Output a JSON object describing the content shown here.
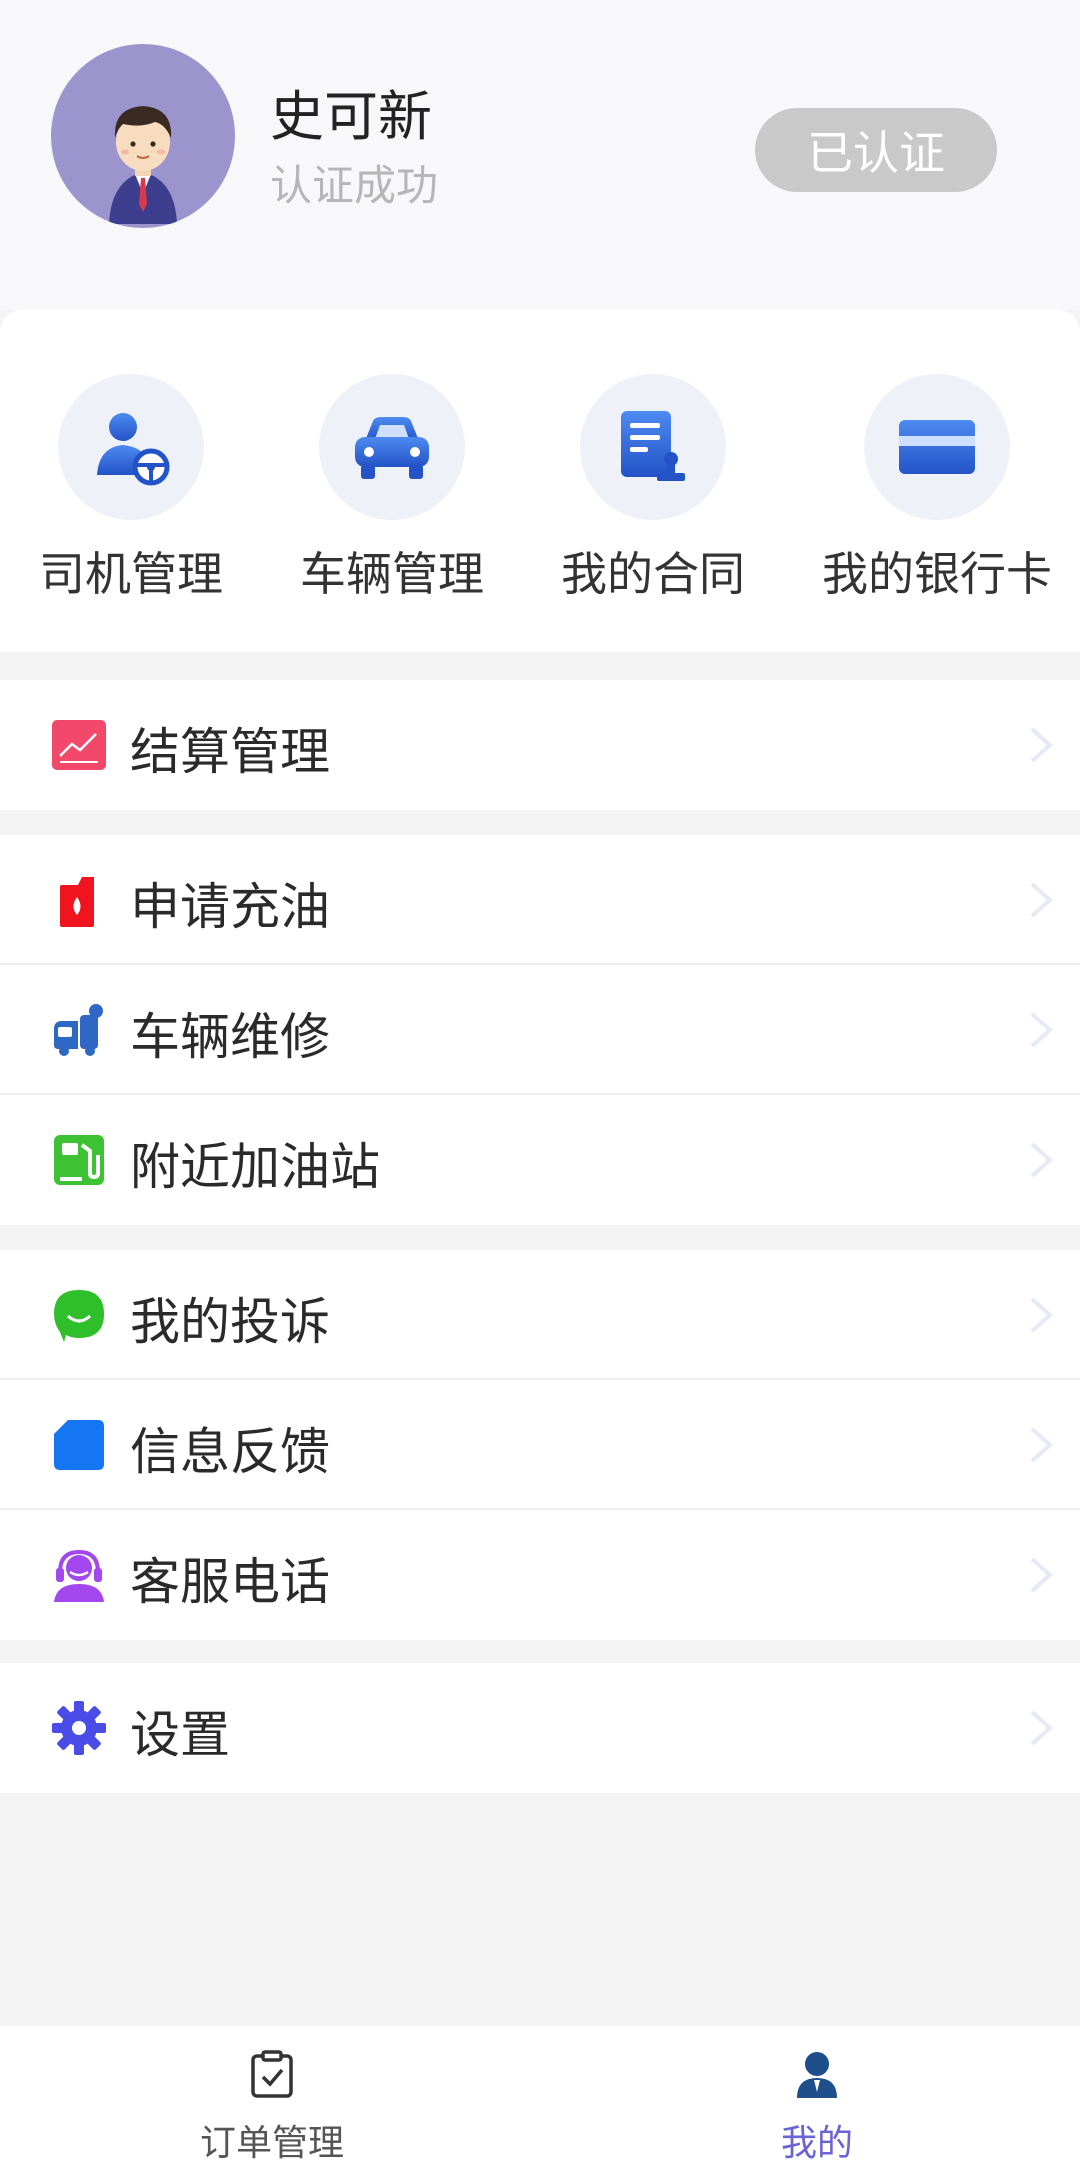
{
  "profile": {
    "name": "史可新",
    "status": "认证成功",
    "badge": "已认证",
    "avatar_icon": "user-avatar-icon"
  },
  "quick_actions": [
    {
      "label": "司机管理",
      "icon": "driver-icon"
    },
    {
      "label": "车辆管理",
      "icon": "car-icon"
    },
    {
      "label": "我的合同",
      "icon": "contract-icon"
    },
    {
      "label": "我的银行卡",
      "icon": "bank-card-icon"
    }
  ],
  "menu": {
    "settlement": {
      "label": "结算管理",
      "icon": "settlement-chart-icon",
      "color": "#f2496b"
    },
    "refuel": {
      "label": "申请充油",
      "icon": "fuel-can-icon",
      "color": "#f0141e"
    },
    "repair": {
      "label": "车辆维修",
      "icon": "repair-truck-icon",
      "color": "#2e67c4"
    },
    "gas_station": {
      "label": "附近加油站",
      "icon": "gas-station-icon",
      "color": "#3cc232"
    },
    "complaint": {
      "label": "我的投诉",
      "icon": "chat-bubble-icon",
      "color": "#2fbf2a"
    },
    "feedback": {
      "label": "信息反馈",
      "icon": "feedback-doc-icon",
      "color": "#1576f2"
    },
    "service_phone": {
      "label": "客服电话",
      "icon": "headset-icon",
      "color": "#a248ee"
    },
    "settings": {
      "label": "设置",
      "icon": "gear-icon",
      "color": "#4b4be8"
    }
  },
  "bottom_nav": {
    "orders": {
      "label": "订单管理",
      "icon": "clipboard-check-icon"
    },
    "mine": {
      "label": "我的",
      "icon": "person-icon",
      "active": true
    }
  },
  "colors": {
    "accent": "#6b62d6",
    "badge_bg": "#c9c9c9"
  }
}
